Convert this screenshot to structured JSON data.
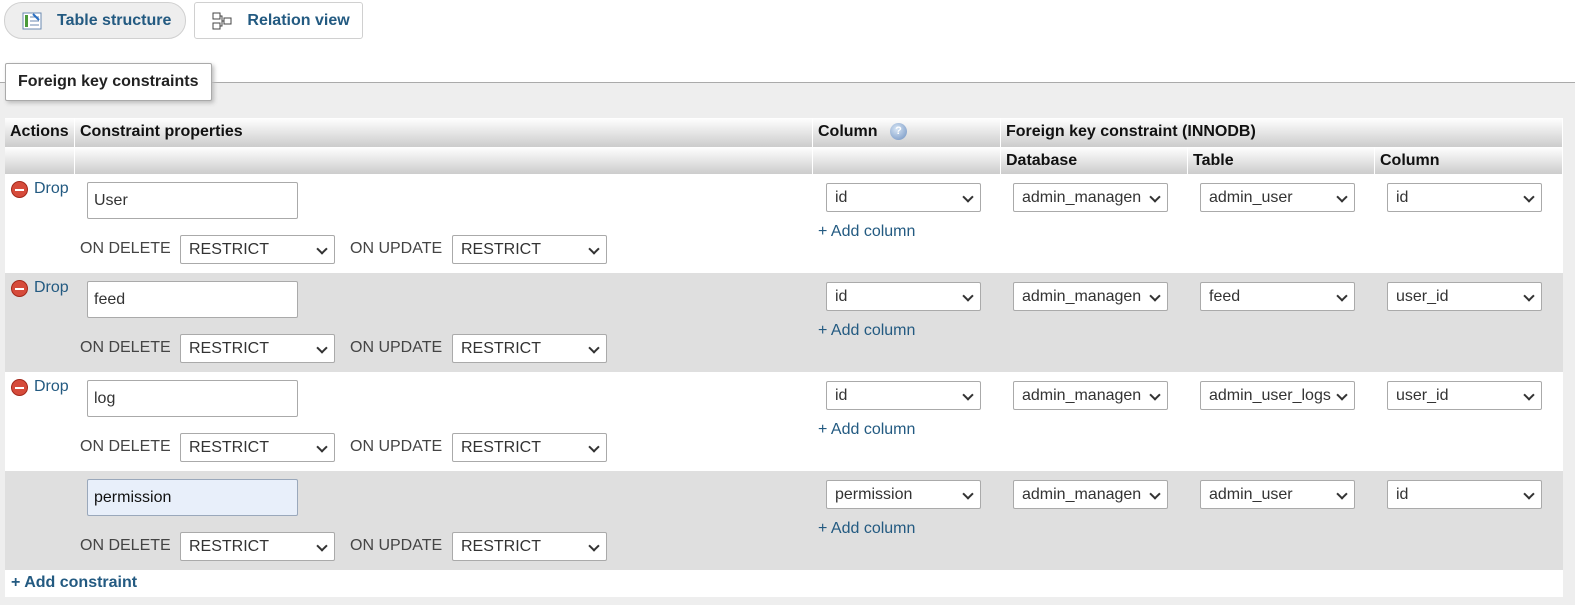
{
  "tabs": [
    {
      "label": "Table structure",
      "icon": "table-structure-icon"
    },
    {
      "label": "Relation view",
      "icon": "relation-view-icon"
    }
  ],
  "legend": "Foreign key constraints",
  "headers": {
    "actions": "Actions",
    "constraint_properties": "Constraint properties",
    "column": "Column",
    "foreign_key": "Foreign key constraint (INNODB)",
    "database": "Database",
    "table": "Table",
    "fk_column": "Column"
  },
  "drop_label": "Drop",
  "on_delete_label": "ON DELETE",
  "on_update_label": "ON UPDATE",
  "add_column_label": "+ Add column",
  "add_constraint_label": "+ Add constraint",
  "rows": [
    {
      "name": "User",
      "on_delete": "RESTRICT",
      "on_update": "RESTRICT",
      "column": "id",
      "database": "admin_managen",
      "table": "admin_user",
      "fk_column": "id"
    },
    {
      "name": "feed",
      "on_delete": "RESTRICT",
      "on_update": "RESTRICT",
      "column": "id",
      "database": "admin_managen",
      "table": "feed",
      "fk_column": "user_id"
    },
    {
      "name": "log",
      "on_delete": "RESTRICT",
      "on_update": "RESTRICT",
      "column": "id",
      "database": "admin_managen",
      "table": "admin_user_logs",
      "fk_column": "user_id"
    },
    {
      "name": "permission",
      "on_delete": "RESTRICT",
      "on_update": "RESTRICT",
      "column": "permission",
      "database": "admin_managen",
      "table": "admin_user",
      "fk_column": "id"
    }
  ]
}
